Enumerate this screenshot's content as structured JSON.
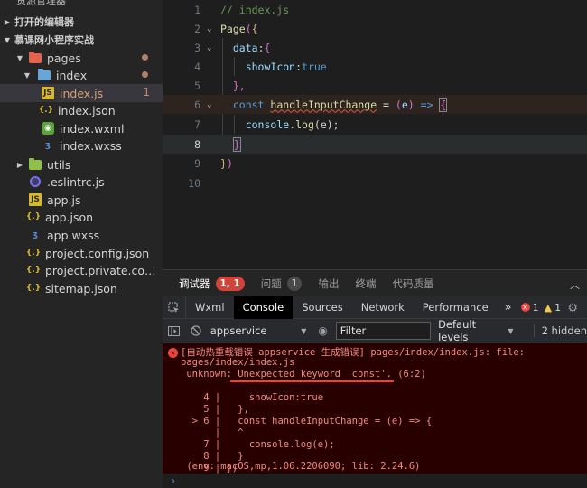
{
  "sidebar": {
    "header": "资源管理器",
    "sections": [
      {
        "label": "打开的编辑器",
        "expanded": false
      },
      {
        "label": "慕课网小程序实战",
        "expanded": true
      }
    ],
    "tree": [
      {
        "label": "pages",
        "icon": "folder-red-icon",
        "expanded": true,
        "modified_dot": true
      },
      {
        "label": "index",
        "icon": "folder-blue-icon",
        "expanded": true,
        "modified_dot": true
      },
      {
        "label": "index.js",
        "icon": "js-file-icon",
        "selected": true,
        "problems": "1"
      },
      {
        "label": "index.json",
        "icon": "json-file-icon"
      },
      {
        "label": "index.wxml",
        "icon": "wxml-file-icon"
      },
      {
        "label": "index.wxss",
        "icon": "wxss-file-icon"
      },
      {
        "label": "utils",
        "icon": "folder-green-icon",
        "expanded": false
      },
      {
        "label": ".eslintrc.js",
        "icon": "eslint-file-icon"
      },
      {
        "label": "app.js",
        "icon": "js-file-icon"
      },
      {
        "label": "app.json",
        "icon": "json-file-icon"
      },
      {
        "label": "app.wxss",
        "icon": "wxss-file-icon"
      },
      {
        "label": "project.config.json",
        "icon": "json-file-icon"
      },
      {
        "label": "project.private.config...",
        "icon": "json-file-icon"
      },
      {
        "label": "sitemap.json",
        "icon": "json-file-icon"
      }
    ]
  },
  "editor": {
    "line_numbers": [
      "1",
      "2",
      "3",
      "4",
      "5",
      "6",
      "7",
      "8",
      "9",
      "10"
    ],
    "lines": {
      "l1": "// index.js",
      "l2_fn": "Page",
      "l2_paren": "(",
      "l2_brace": "{",
      "l3_key": "data",
      "l3_colon": ":",
      "l3_brace": "{",
      "l4_key": "showIcon",
      "l4_colon": ":",
      "l4_val": "true",
      "l5": "},",
      "l6_kw": "const",
      "l6_name": "handleInputChange",
      "l6_eq": " = ",
      "l6_paren_open": "(",
      "l6_arg": "e",
      "l6_paren_close": ")",
      "l6_arrow": " => ",
      "l6_brace": "{",
      "l7_obj": "console",
      "l7_dot": ".",
      "l7_fn": "log",
      "l7_args": "(e);",
      "l8": "}",
      "l9_brace": "}",
      "l9_paren": ")"
    },
    "current_line": "8"
  },
  "panel": {
    "tabs": [
      {
        "label": "调试器",
        "badge": "1, 1",
        "active": true
      },
      {
        "label": "问题",
        "badge": "1"
      },
      {
        "label": "输出"
      },
      {
        "label": "终端"
      },
      {
        "label": "代码质量"
      }
    ],
    "collapse_glyph": "︿"
  },
  "devtools": {
    "tabs": [
      "Wxml",
      "Console",
      "Sources",
      "Network",
      "Performance"
    ],
    "active_tab": "Console",
    "more": "»",
    "error_count": "1",
    "warning_count": "1",
    "context": "appservice",
    "filter_placeholder": "Filter",
    "levels": "Default levels",
    "hidden": "2 hidden"
  },
  "console": {
    "lines": [
      "[自动热重载错误 appservice 生成错误] pages/index/index.js: file:",
      "pages/index/index.js",
      " unknown: Unexpected keyword 'const'. (6:2)",
      "",
      "    4 |     showIcon:true",
      "    5 |   },",
      "  > 6 |   const handleInputChange = (e) => {",
      "      |   ^",
      "    7 |     console.log(e);",
      "    8 |   }",
      "    9 | })",
      " (env: macOS,mp,1.06.2206090; lib: 2.24.6)"
    ],
    "prompt": "›"
  },
  "colors": {
    "accent_red": "#d1443a",
    "error_text": "#f28b82",
    "error_bg": "#290000",
    "selected_row": "#37373d"
  }
}
